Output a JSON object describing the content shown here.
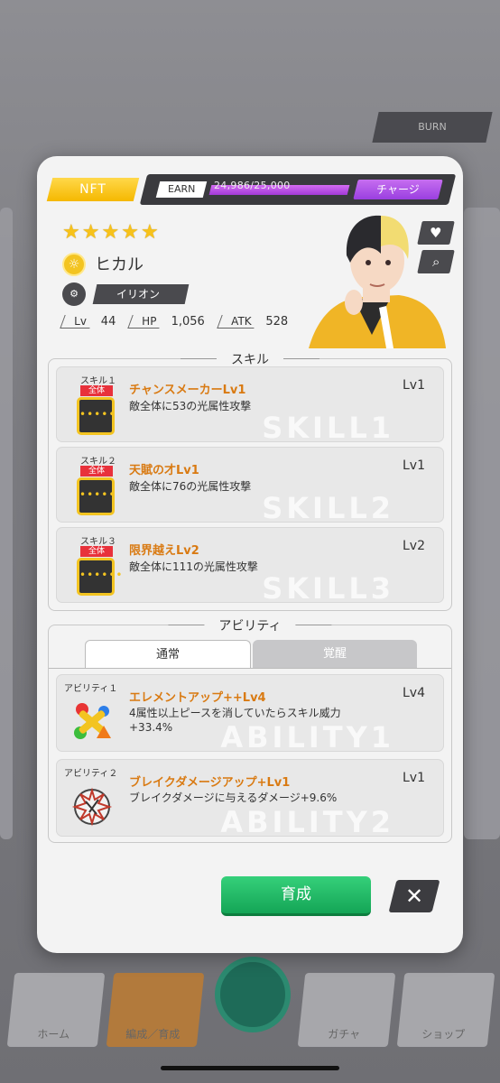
{
  "nft_label": "NFT",
  "earn": {
    "label": "EARN",
    "value": "24,986/25,000",
    "fill_fraction": 0.9994,
    "charge_label": "チャージ"
  },
  "character": {
    "rarity_stars": 5,
    "name": "ヒカル",
    "group": "イリオン",
    "stats": {
      "lv_label": "Lv",
      "lv": "44",
      "hp_label": "HP",
      "hp": "1,056",
      "atk_label": "ATK",
      "atk": "528"
    }
  },
  "skills": {
    "title": "スキル",
    "items": [
      {
        "num": "スキル１",
        "tag": "全体",
        "name": "チャンスメーカーLv1",
        "desc": "敵全体に53の光属性攻撃",
        "lv": "Lv1",
        "icon_text": "•••••",
        "watermark": "SKILL1"
      },
      {
        "num": "スキル２",
        "tag": "全体",
        "name": "天賦の才Lv1",
        "desc": "敵全体に76の光属性攻撃",
        "lv": "Lv1",
        "icon_text": "•••••",
        "watermark": "SKILL2"
      },
      {
        "num": "スキル３",
        "tag": "全体",
        "name": "限界越えLv2",
        "desc": "敵全体に111の光属性攻撃",
        "lv": "Lv2",
        "icon_text": "••••••",
        "watermark": "SKILL3"
      }
    ]
  },
  "abilities": {
    "title": "アビリティ",
    "tab_normal": "通常",
    "tab_awaken": "覚醒",
    "items": [
      {
        "num": "アビリティ１",
        "name": "エレメントアップ++Lv4",
        "desc_line1": "4属性以上ピースを消していたらスキル威力",
        "desc_line2": "+33.4%",
        "lv": "Lv4",
        "watermark": "ABILITY1"
      },
      {
        "num": "アビリティ２",
        "name": "ブレイクダメージアップ+Lv1",
        "desc_line1": "ブレイクダメージに与えるダメージ+9.6%",
        "desc_line2": "",
        "lv": "Lv1",
        "watermark": "ABILITY2"
      }
    ]
  },
  "grow_button": "育成",
  "close_symbol": "✕",
  "background": {
    "top_button": "BURN",
    "nav": [
      "ホーム",
      "編成／育成",
      "ガチャ",
      "ショップ"
    ]
  },
  "colors": {
    "accent_orange": "#d97a12",
    "nft_yellow": "#f5b800",
    "charge_purple": "#a23ad6",
    "grow_green": "#14a556",
    "tag_red": "#e8313b"
  }
}
